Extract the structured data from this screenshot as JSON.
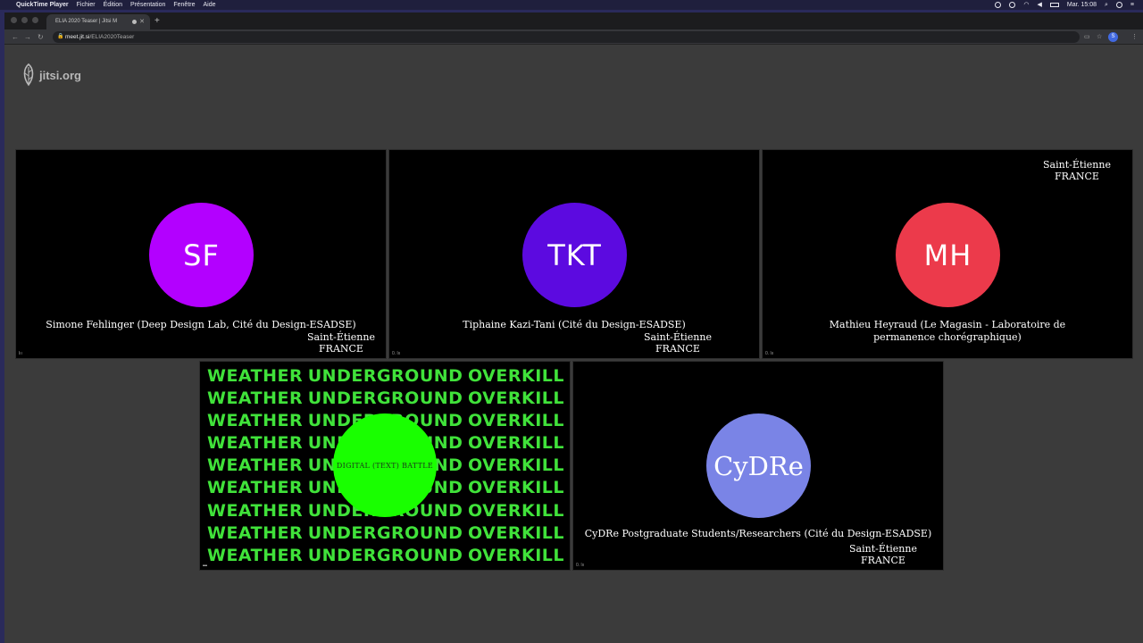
{
  "menubar": {
    "app": "QuickTime Player",
    "items": [
      "Fichier",
      "Édition",
      "Présentation",
      "Fenêtre",
      "Aide"
    ],
    "clock": "Mar. 15:08"
  },
  "browser": {
    "tab_title": "ELIA 2020 Teaser | Jitsi M",
    "url_domain": "meet.jit.si",
    "url_path": "/ELIA2020Teaser",
    "profile_initial": "S"
  },
  "jitsi": {
    "logo_text": "jitsi.org"
  },
  "participants": [
    {
      "initials": "SF",
      "color": "#b300ff",
      "name": "Simone Fehlinger (Deep Design Lab, Cité du Design-ESADSE)",
      "location_line1": "Saint-Étienne",
      "location_line2": "FRANCE",
      "quality": "lıı"
    },
    {
      "initials": "TKT",
      "color": "#5c0ae0",
      "name": "Tiphaine Kazi-Tani (Cité du Design-ESADSE)",
      "location_line1": "Saint-Étienne",
      "location_line2": "FRANCE",
      "quality": "0. lıı"
    },
    {
      "initials": "MH",
      "color": "#ec3a4b",
      "name": "Mathieu Heyraud (Le Magasin - Laboratoire de permanence chorégraphique)",
      "location_line1": "Saint-Étienne",
      "location_line2": "FRANCE",
      "quality": "0. lıı"
    },
    {
      "initials": "CyDRe",
      "color": "#7a84e6",
      "name": "CyDRe Postgraduate Students/Researchers (Cité du Design-ESADSE)",
      "location_line1": "Saint-Étienne",
      "location_line2": "FRANCE",
      "quality": "0. lıı"
    }
  ],
  "shared_video": {
    "words": [
      "WEATHER",
      "UNDERGROUND",
      "OVERKILL"
    ],
    "rows": 9,
    "center_label": "DIGITAL (TEXT) BATTLE",
    "text_color": "#40e23a",
    "blob_color": "#19ff00"
  }
}
